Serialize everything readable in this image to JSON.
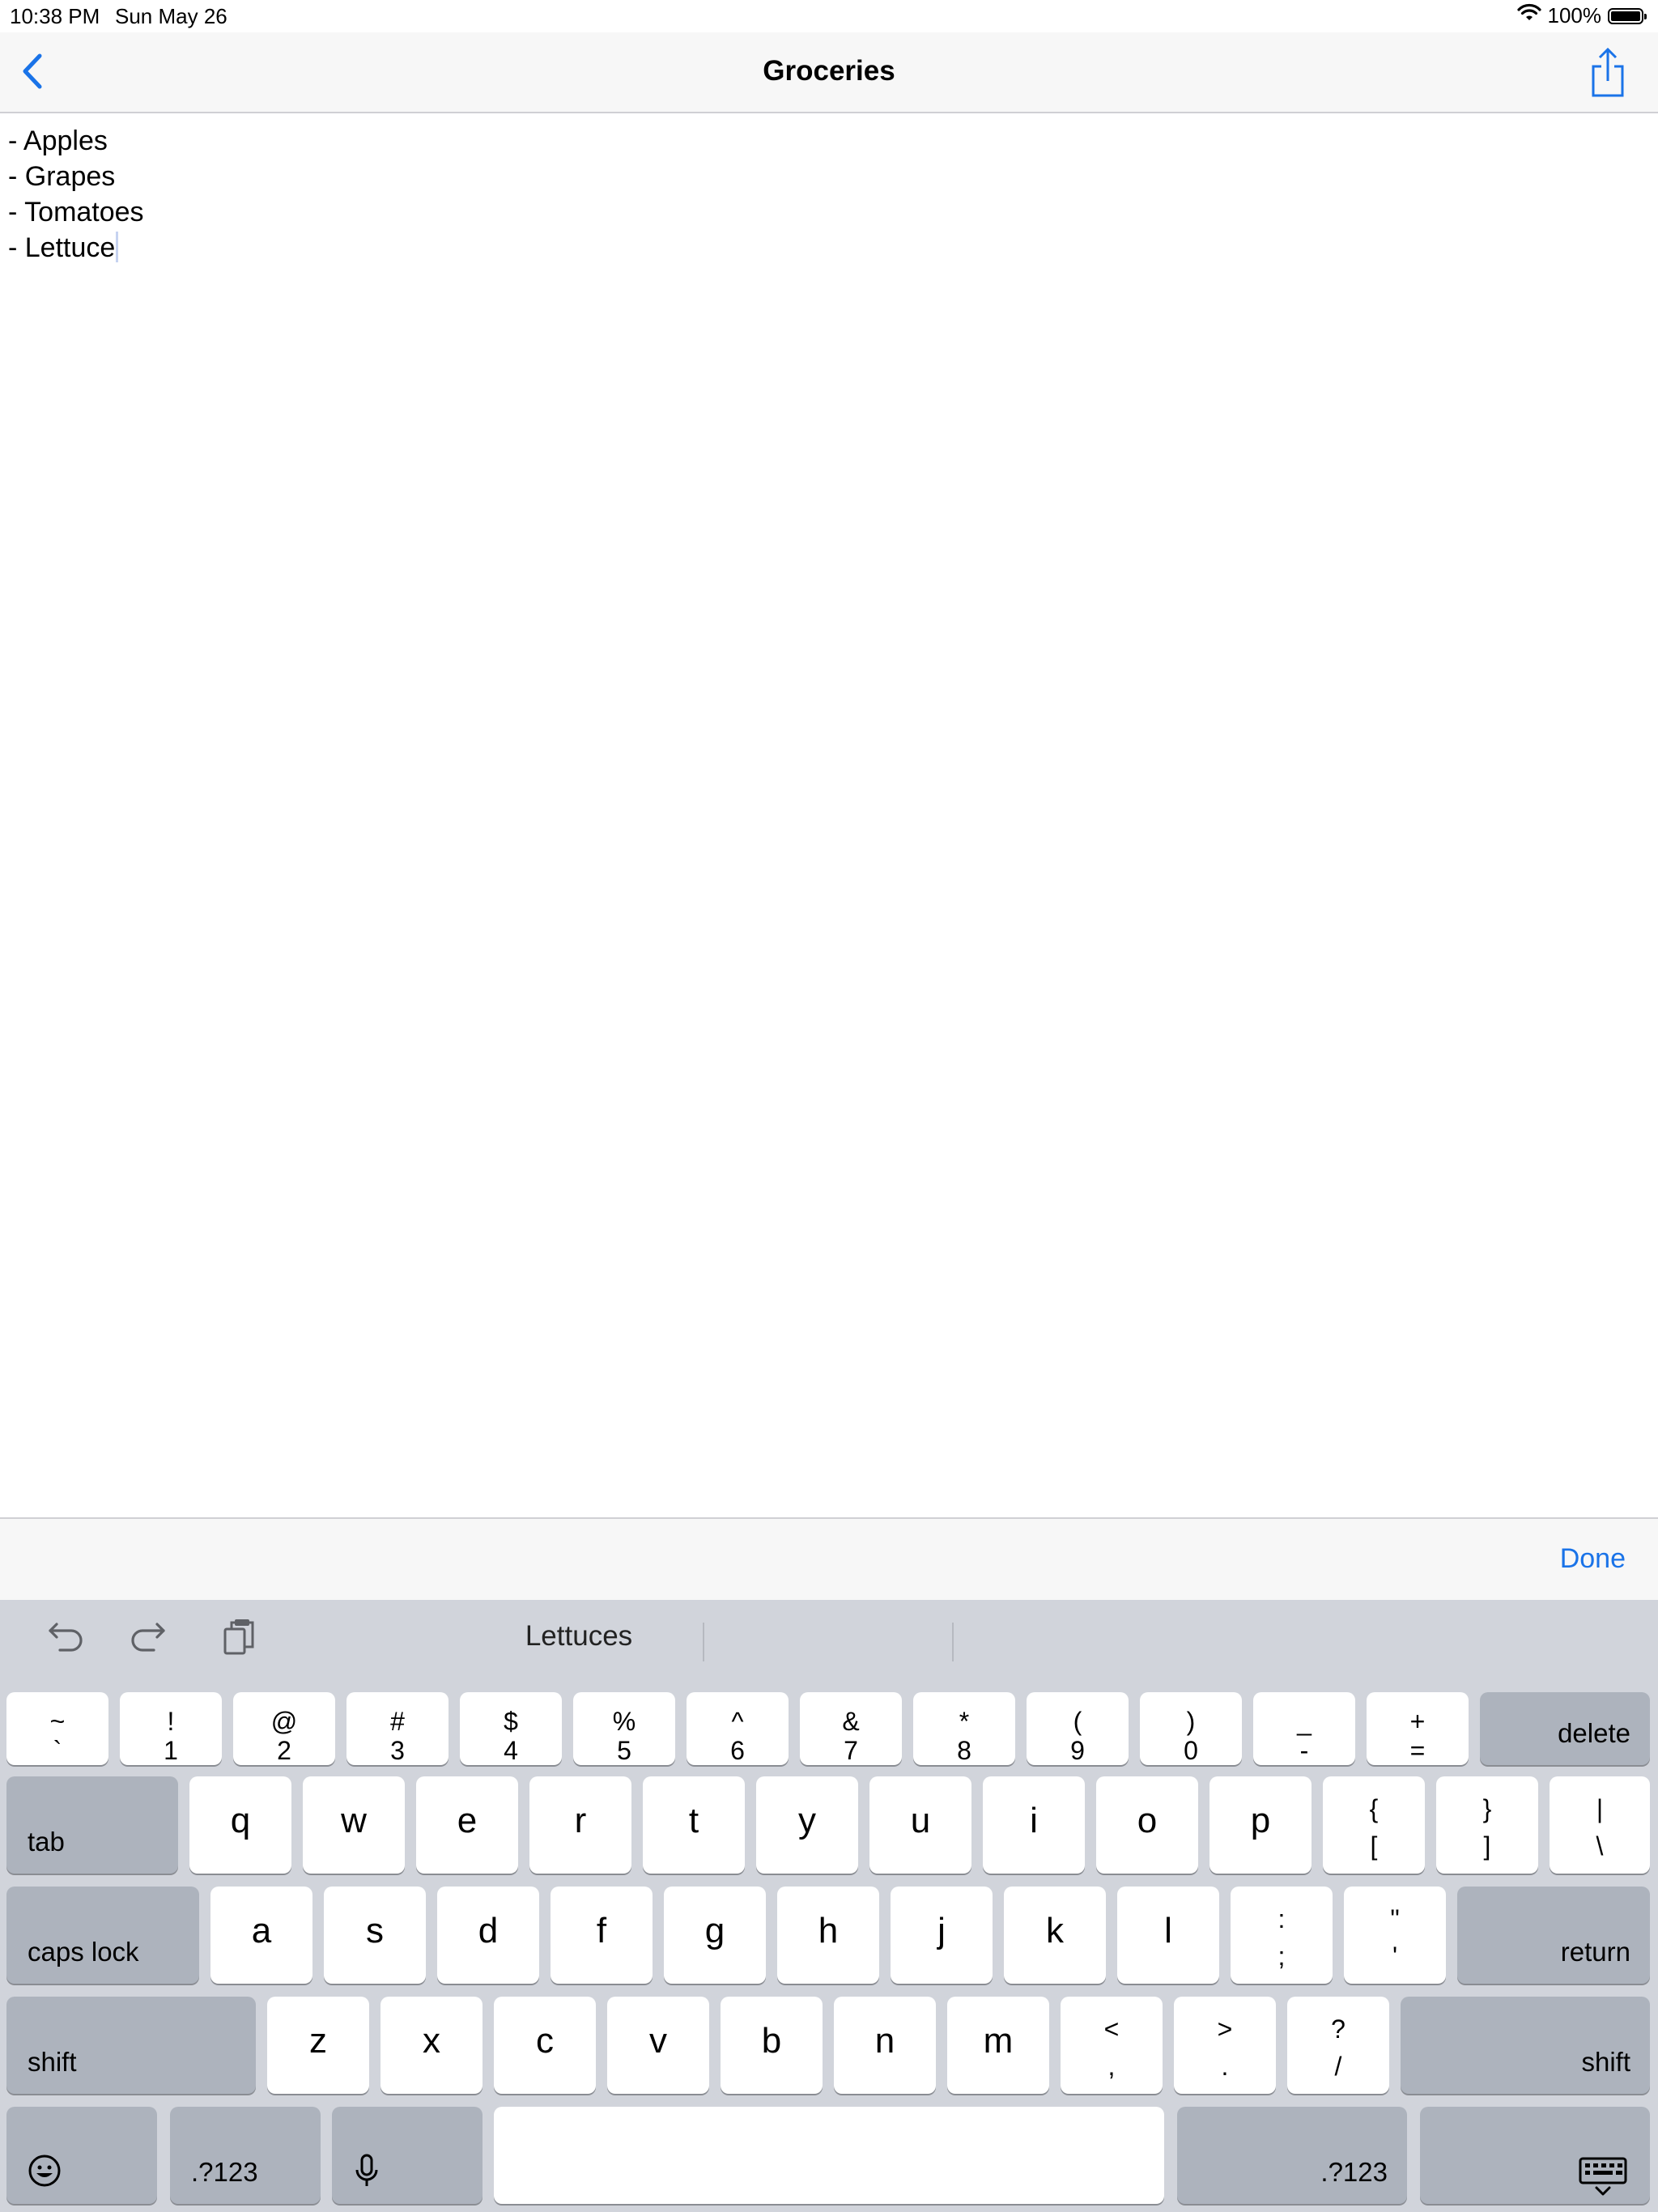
{
  "status_bar": {
    "time": "10:38 PM",
    "date": "Sun May 26",
    "battery_percent": "100%",
    "battery_level": 1.0,
    "icons": [
      "wifi-icon",
      "battery-icon"
    ]
  },
  "nav": {
    "title": "Groceries",
    "back_icon": "chevron-left-icon",
    "share_icon": "share-icon",
    "accent_color": "#1a73e8"
  },
  "note": {
    "lines": [
      "- Apples",
      "- Grapes",
      "- Tomatoes",
      "- Lettuce"
    ]
  },
  "accessory": {
    "done_label": "Done"
  },
  "keyboard": {
    "shortcuts": [
      "undo-icon",
      "redo-icon",
      "paste-icon"
    ],
    "suggestions": [
      "Lettuces",
      "",
      ""
    ],
    "row1": [
      {
        "top": "~",
        "bottom": "`"
      },
      {
        "top": "!",
        "bottom": "1"
      },
      {
        "top": "@",
        "bottom": "2"
      },
      {
        "top": "#",
        "bottom": "3"
      },
      {
        "top": "$",
        "bottom": "4"
      },
      {
        "top": "%",
        "bottom": "5"
      },
      {
        "top": "^",
        "bottom": "6"
      },
      {
        "top": "&",
        "bottom": "7"
      },
      {
        "top": "*",
        "bottom": "8"
      },
      {
        "top": "(",
        "bottom": "9"
      },
      {
        "top": ")",
        "bottom": "0"
      },
      {
        "top": "_",
        "bottom": "-"
      },
      {
        "top": "+",
        "bottom": "="
      }
    ],
    "delete_label": "delete",
    "tab_label": "tab",
    "row2": [
      "q",
      "w",
      "e",
      "r",
      "t",
      "y",
      "u",
      "i",
      "o",
      "p"
    ],
    "row2_dual": [
      {
        "top": "{",
        "bottom": "["
      },
      {
        "top": "}",
        "bottom": "]"
      },
      {
        "top": "|",
        "bottom": "\\"
      }
    ],
    "caps_lock_label": "caps lock",
    "row3": [
      "a",
      "s",
      "d",
      "f",
      "g",
      "h",
      "j",
      "k",
      "l"
    ],
    "row3_dual": [
      {
        "top": ":",
        "bottom": ";"
      },
      {
        "top": "\"",
        "bottom": "'"
      }
    ],
    "return_label": "return",
    "shift_label": "shift",
    "row4": [
      "z",
      "x",
      "c",
      "v",
      "b",
      "n",
      "m"
    ],
    "row4_dual": [
      {
        "top": "<",
        "bottom": ","
      },
      {
        "top": ">",
        "bottom": "."
      },
      {
        "top": "?",
        "bottom": "/"
      }
    ],
    "numbers_label": ".?123",
    "bottom_icons": [
      "emoji-icon",
      "microphone-icon",
      "keyboard-dismiss-icon"
    ]
  }
}
